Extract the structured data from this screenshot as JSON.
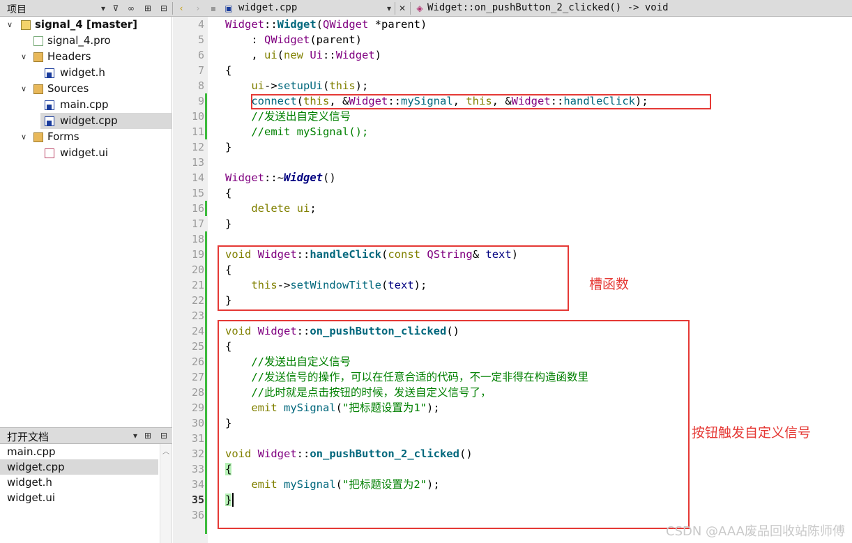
{
  "toolbar": {
    "project_label": "项目",
    "file_name": "widget.cpp",
    "function_name": "Widget::on_pushButton_2_clicked() -> void"
  },
  "project_tree": [
    {
      "label": "signal_4 [master]",
      "kind": "project",
      "bold": true
    },
    {
      "label": "signal_4.pro",
      "kind": "pro"
    },
    {
      "label": "Headers",
      "kind": "folder"
    },
    {
      "label": "widget.h",
      "kind": "header"
    },
    {
      "label": "Sources",
      "kind": "folder"
    },
    {
      "label": "main.cpp",
      "kind": "source"
    },
    {
      "label": "widget.cpp",
      "kind": "source",
      "selected": true
    },
    {
      "label": "Forms",
      "kind": "folder"
    },
    {
      "label": "widget.ui",
      "kind": "form"
    }
  ],
  "open_documents": {
    "title": "打开文档",
    "items": [
      {
        "label": "main.cpp"
      },
      {
        "label": "widget.cpp",
        "selected": true
      },
      {
        "label": "widget.h"
      },
      {
        "label": "widget.ui"
      }
    ]
  },
  "code": {
    "line_numbers": [
      "4",
      "5",
      "6",
      "7",
      "8",
      "9",
      "10",
      "11",
      "12",
      "13",
      "14",
      "15",
      "16",
      "17",
      "18",
      "19",
      "20",
      "21",
      "22",
      "23",
      "24",
      "25",
      "26",
      "27",
      "28",
      "29",
      "30",
      "31",
      "32",
      "33",
      "34",
      "35",
      "36"
    ],
    "current_line": "35",
    "comment_line10": "//发送出自定义信号",
    "comment_line11": "//emit mySignal();",
    "comment_line26": "//发送出自定义信号",
    "comment_line27": "//发送信号的操作，可以在任意合适的代码，不一定非得在构造函数里",
    "comment_line28": "//此时就是点击按钮的时候，发送自定义信号了，",
    "string_line29": "\"把标题设置为1\"",
    "string_line34": "\"把标题设置为2\""
  },
  "annotations": {
    "slot_label": "槽函数",
    "button_label": "按钮触发自定义信号"
  },
  "watermark": "CSDN @AAA废品回收站陈师傅",
  "colors": {
    "keyword": "#808000",
    "type": "#800080",
    "function": "#00677c",
    "comment": "#008000",
    "highlight_box": "#e53935"
  }
}
